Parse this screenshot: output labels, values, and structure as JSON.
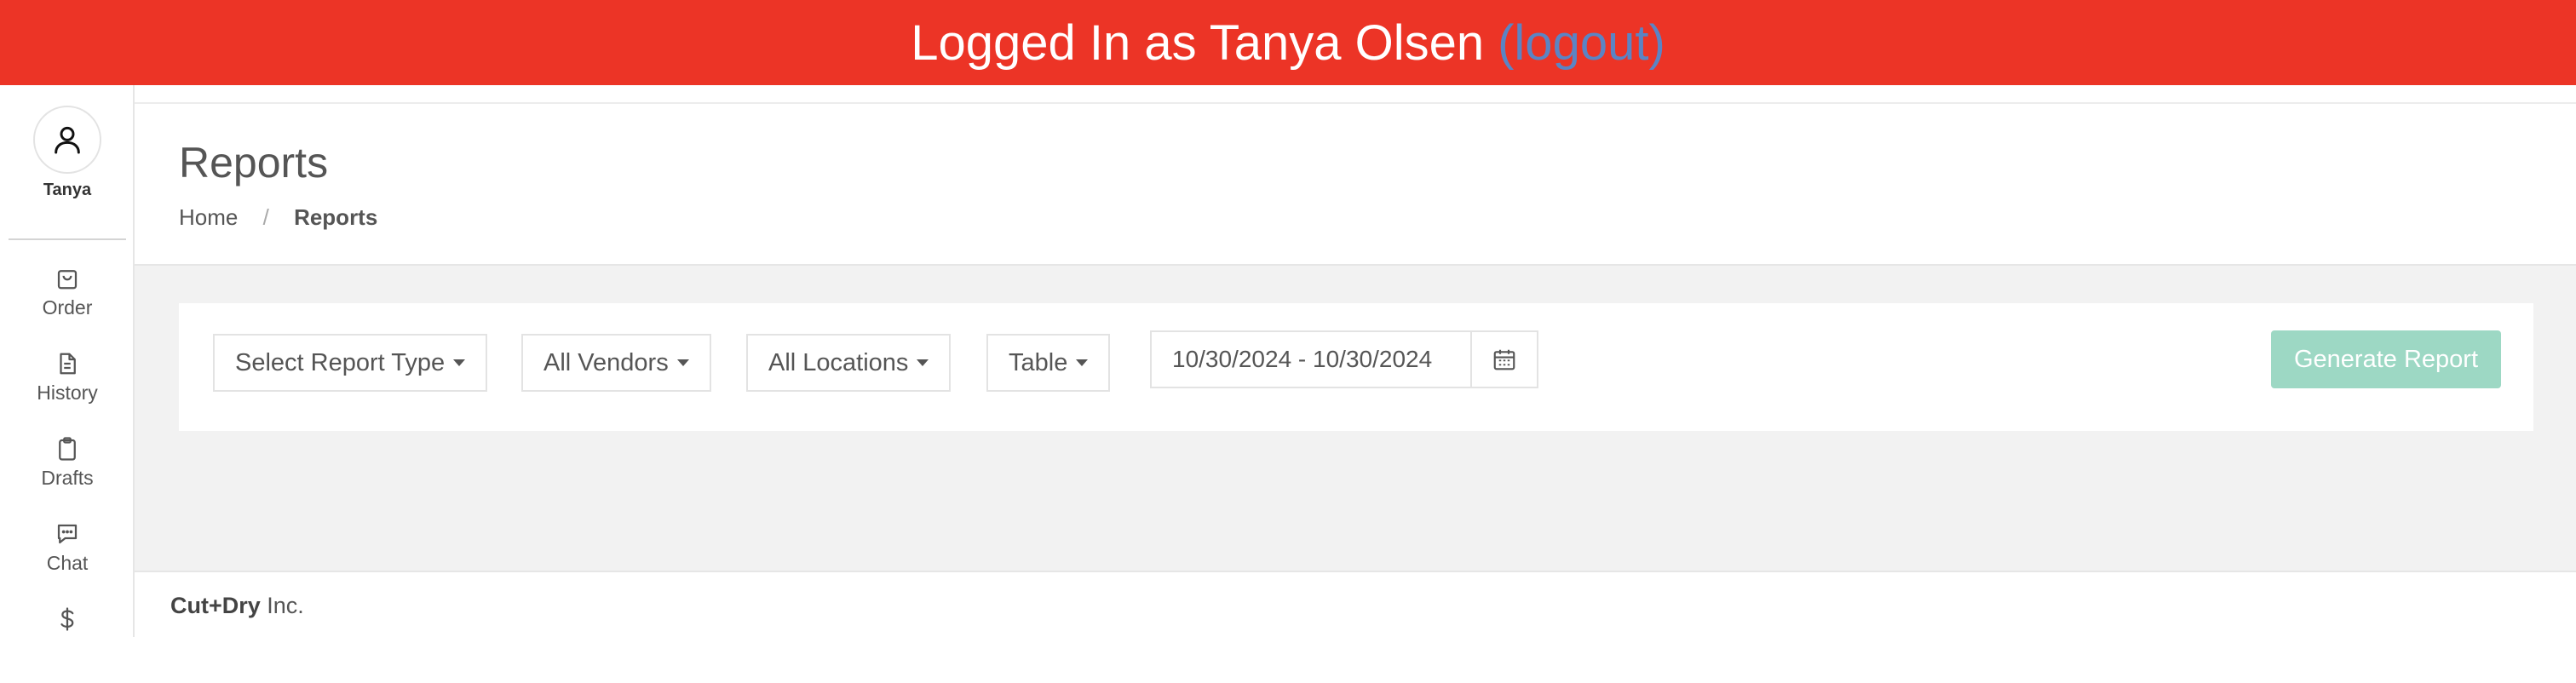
{
  "banner": {
    "text": "Logged In as Tanya Olsen",
    "logout_label": "(logout)"
  },
  "sidebar": {
    "user_name": "Tanya",
    "items": [
      {
        "label": "Order",
        "icon": "shopping-bag-icon"
      },
      {
        "label": "History",
        "icon": "document-icon"
      },
      {
        "label": "Drafts",
        "icon": "clipboard-icon"
      },
      {
        "label": "Chat",
        "icon": "chat-icon"
      },
      {
        "label": "",
        "icon": "dollar-icon"
      }
    ]
  },
  "page": {
    "title": "Reports",
    "breadcrumb": {
      "home": "Home",
      "separator": "/",
      "current": "Reports"
    }
  },
  "filters": {
    "report_type": "Select Report Type",
    "vendors": "All Vendors",
    "locations": "All Locations",
    "view": "Table",
    "date_range": "10/30/2024 - 10/30/2024",
    "generate_label": "Generate Report"
  },
  "footer": {
    "company_bold": "Cut+Dry",
    "company_rest": " Inc."
  },
  "colors": {
    "banner": "#ec3426",
    "logout_link": "#5b84c4",
    "generate_button": "#9dd8c4",
    "content_bg": "#f2f2f2"
  }
}
